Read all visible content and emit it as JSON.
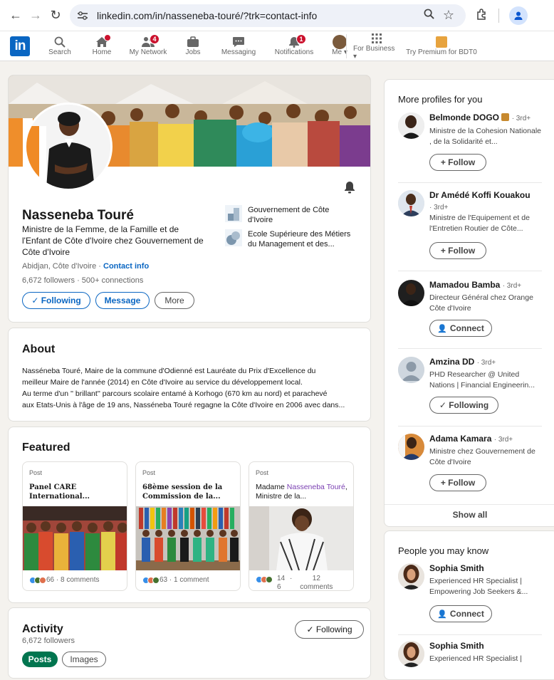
{
  "browser": {
    "url": "linkedin.com/in/nasseneba-touré/?trk=contact-info",
    "back_icon": "←",
    "forward_icon": "→",
    "reload_icon": "↻",
    "tune_icon": "⚙",
    "zoom_icon": "🔍",
    "star_icon": "☆",
    "ext_icon": "⧉",
    "profile_icon": "👤"
  },
  "nav": {
    "logo": "in",
    "items": [
      {
        "label": "Search",
        "icon": "search-icon",
        "glyph": "🔍"
      },
      {
        "label": "Home",
        "icon": "home-icon",
        "glyph": "⌂",
        "badge_dot": true
      },
      {
        "label": "My Network",
        "icon": "network-icon",
        "glyph": "👥",
        "badge": "4"
      },
      {
        "label": "Jobs",
        "icon": "briefcase-icon",
        "glyph": "💼"
      },
      {
        "label": "Messaging",
        "icon": "message-icon",
        "glyph": "💬"
      },
      {
        "label": "Notifications",
        "icon": "bell-icon",
        "glyph": "🔔",
        "badge": "1"
      },
      {
        "label": "Me",
        "icon": "avatar-icon",
        "glyph": "▾"
      },
      {
        "label": "For Business",
        "icon": "grid-icon",
        "glyph": "⋮⋮⋮"
      },
      {
        "label": "Try Premium for BDT0",
        "icon": "premium-icon",
        "glyph": ""
      }
    ]
  },
  "profile": {
    "name": "Nasseneba Touré",
    "headline": "Ministre de la Femme, de la Famille et de l'Enfant de Côte d'Ivoire chez Gouvernement de Côte d'Ivoire",
    "location": "Abidjan, Côte d'Ivoire ·",
    "contact_info": "Contact info",
    "followers": "6,672 followers",
    "connections": "· 500+ connections",
    "buttons": {
      "following": "✓ Following",
      "message": "Message",
      "more": "More"
    },
    "orgs": [
      {
        "name": "Gouvernement de Côte d'Ivoire"
      },
      {
        "name": "Ecole Supérieure des Métiers du Management et des..."
      }
    ]
  },
  "about": {
    "title": "About",
    "text_line1": "Nasséneba Touré, Maire de la commune d'Odienné est Lauréate du Prix d'Excellence du",
    "text_line2": "meilleur Maire de l'année (2014) en Côte d'Ivoire au service du développement local.",
    "text_line3": "Au terme d'un '' brillant'' parcours scolaire entamé à Korhogo (670 km au nord) et parachevé",
    "text_line4": "aux Etats-Unis à l'âge de 19 ans, Nasséneba Touré regagne la Côte d'Ivoire en 2006 avec dans..."
  },
  "featured": {
    "title": "Featured",
    "items": [
      {
        "tag": "Post",
        "title": "Panel CARE International...",
        "reactions": "66 · 8 comments"
      },
      {
        "tag": "Post",
        "title": "68ème session de la Commission de la...",
        "reactions": "63 · 1 comment"
      },
      {
        "tag": "Post",
        "title_pre": "Madame ",
        "title_link": "Nasseneba Touré",
        "title_post": ", Ministre de la...",
        "reactions_count": "14 6",
        "reactions_sep": "·",
        "reactions_comments": "12 comments"
      }
    ]
  },
  "activity": {
    "title": "Activity",
    "followers": "6,672 followers",
    "following_btn": "✓ Following",
    "tabs": [
      "Posts",
      "Images"
    ]
  },
  "more_profiles": {
    "title": "More profiles for you",
    "people": [
      {
        "name": "Belmonde DOGO",
        "degree": "· 3rd+",
        "desc": "Ministre de la Cohesion Nationale , de la Solidarité et...",
        "button": "+ Follow"
      },
      {
        "name": "Dr Amédé Koffi Kouakou",
        "degree": "· 3rd+",
        "desc": "Ministre de l'Equipement et de l'Entretien Routier de Côte...",
        "button": "+ Follow"
      },
      {
        "name": "Mamadou Bamba",
        "degree": "· 3rd+",
        "desc": "Directeur Général chez Orange Côte d'Ivoire",
        "button": "Connect"
      },
      {
        "name": "Amzina DD",
        "degree": "· 3rd+",
        "desc": "PHD Researcher @ United Nations | Financial Engineerin...",
        "button": "✓ Following"
      },
      {
        "name": "Adama Kamara",
        "degree": "· 3rd+",
        "desc": "Ministre chez Gouvernement de Côte d'Ivoire",
        "button": "+ Follow"
      }
    ],
    "show_all": "Show all"
  },
  "people_you_may_know": {
    "title": "People you may know",
    "people": [
      {
        "name": "Sophia Smith",
        "desc": "Experienced HR Specialist | Empowering Job Seekers &...",
        "button": "Connect"
      },
      {
        "name": "Sophia Smith",
        "desc": "Experienced HR Specialist |",
        "button": ""
      }
    ]
  },
  "colors": {
    "brand": "#0a66c2",
    "badge": "#cb112d",
    "posts_tab": "#01754f"
  }
}
